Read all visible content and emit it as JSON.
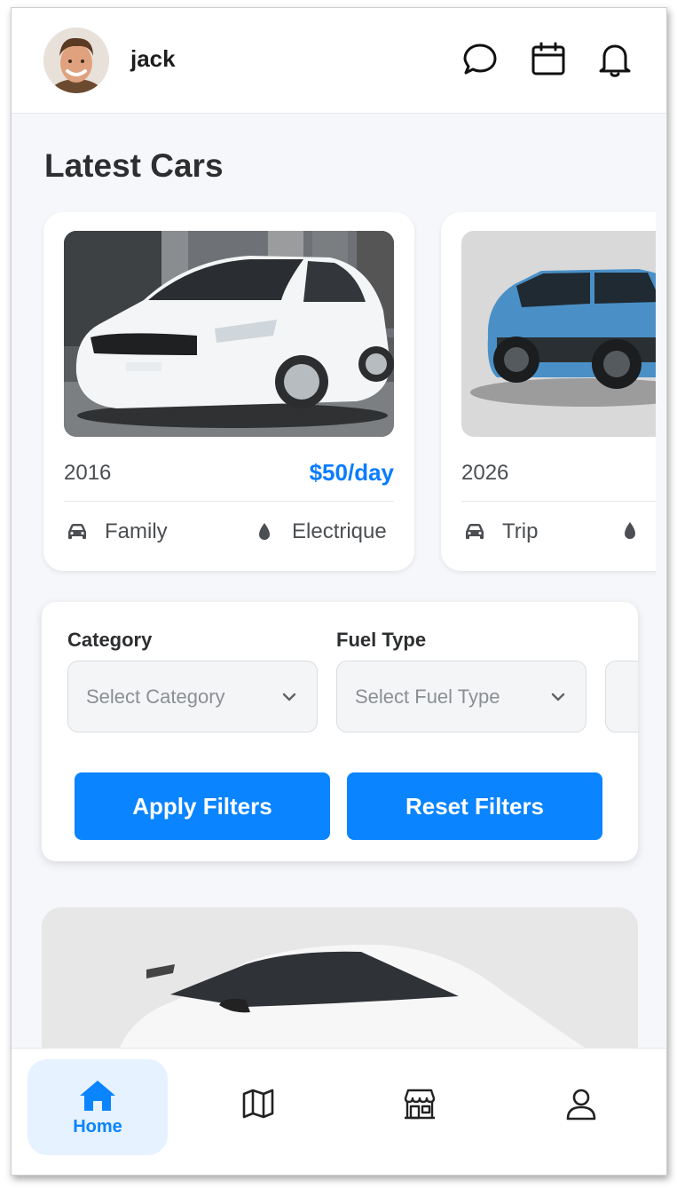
{
  "header": {
    "username": "jack",
    "icons": [
      "chat-bubble-icon",
      "calendar-icon",
      "bell-icon"
    ]
  },
  "section_title": "Latest Cars",
  "cars": [
    {
      "year": "2016",
      "price": "$50/day",
      "category": "Family",
      "fuel": "Electrique",
      "image": "white-hatchback-photo"
    },
    {
      "year": "2026",
      "category": "Trip",
      "image": "blue-suv-photo"
    }
  ],
  "filters": {
    "category_label": "Category",
    "category_placeholder": "Select Category",
    "fuel_label": "Fuel Type",
    "fuel_placeholder": "Select Fuel Type",
    "apply_label": "Apply Filters",
    "reset_label": "Reset Filters"
  },
  "nav": {
    "home_label": "Home",
    "items": [
      "home-icon",
      "map-icon",
      "store-icon",
      "user-icon"
    ]
  },
  "colors": {
    "accent": "#0a84ff",
    "price": "#0a7cff",
    "background": "#f5f7fa",
    "home_highlight": "#e6f2ff"
  }
}
